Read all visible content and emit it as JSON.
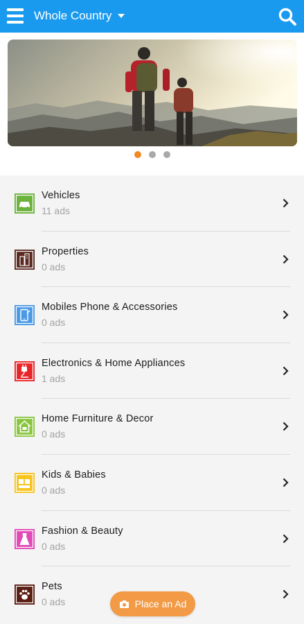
{
  "header": {
    "location_label": "Whole Country"
  },
  "carousel": {
    "slide_count": 3,
    "active_index": 0
  },
  "categories": [
    {
      "name": "Vehicles",
      "count": "11 ads",
      "icon": "car-icon",
      "color": "#6cb33e"
    },
    {
      "name": "Properties",
      "count": "0 ads",
      "icon": "building-icon",
      "color": "#5a2a20"
    },
    {
      "name": "Mobiles Phone & Accessories",
      "count": "0 ads",
      "icon": "phone-icon",
      "color": "#4b9ae6"
    },
    {
      "name": "Electronics & Home Appliances",
      "count": "1 ads",
      "icon": "plug-icon",
      "color": "#e8262a"
    },
    {
      "name": "Home Furniture & Decor",
      "count": "0 ads",
      "icon": "house-icon",
      "color": "#8cc641"
    },
    {
      "name": "Kids & Babies",
      "count": "0 ads",
      "icon": "toys-icon",
      "color": "#f7c51e"
    },
    {
      "name": "Fashion & Beauty",
      "count": "0 ads",
      "icon": "dress-icon",
      "color": "#e24bb7"
    },
    {
      "name": "Pets",
      "count": "0 ads",
      "icon": "paw-icon",
      "color": "#5a1e12"
    }
  ],
  "place_ad": {
    "label": "Place an Ad",
    "icon": "camera-icon",
    "color": "#f29a45"
  },
  "colors": {
    "top_bar": "#1a9aef",
    "carousel_active_dot": "#f08a24"
  }
}
